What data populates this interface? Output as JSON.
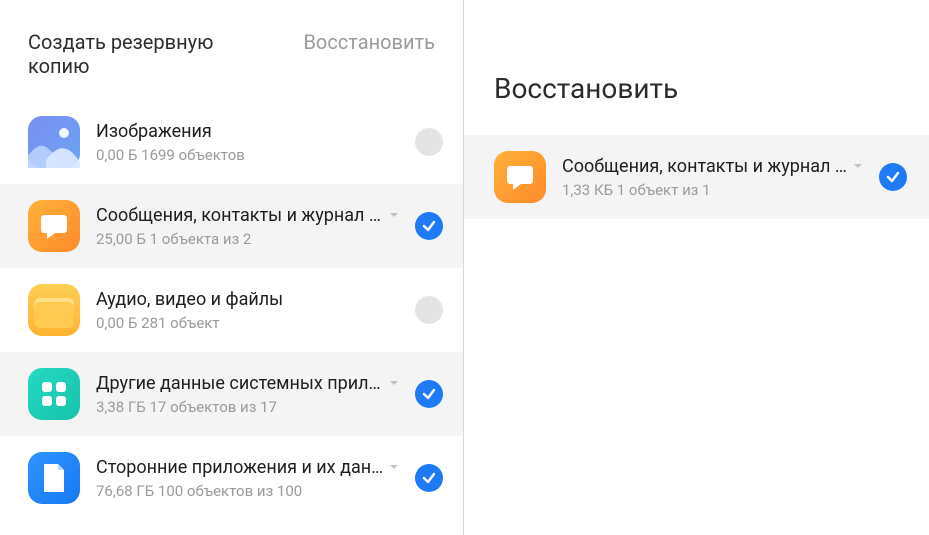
{
  "left": {
    "tabs": {
      "backup": "Создать резервную копию",
      "restore": "Восстановить"
    },
    "items": [
      {
        "title": "Изображения",
        "sub": "0,00 Б  1699 объектов",
        "checked": false,
        "expandable": false
      },
      {
        "title": "Сообщения, контакты и журнал в…",
        "sub": "25,00 Б  1 объекта из 2",
        "checked": true,
        "expandable": true
      },
      {
        "title": "Аудио, видео и файлы",
        "sub": "0,00 Б  281 объект",
        "checked": false,
        "expandable": false
      },
      {
        "title": "Другие данные системных прило…",
        "sub": "3,38 ГБ  17 объектов из 17",
        "checked": true,
        "expandable": true
      },
      {
        "title": "Сторонние приложения и их данн…",
        "sub": "76,68 ГБ  100 объектов из 100",
        "checked": true,
        "expandable": true
      }
    ]
  },
  "right": {
    "title": "Восстановить",
    "items": [
      {
        "title": "Сообщения, контакты и журнал в…",
        "sub": "1,33 КБ  1 объект из 1",
        "checked": true,
        "expandable": true
      }
    ]
  }
}
